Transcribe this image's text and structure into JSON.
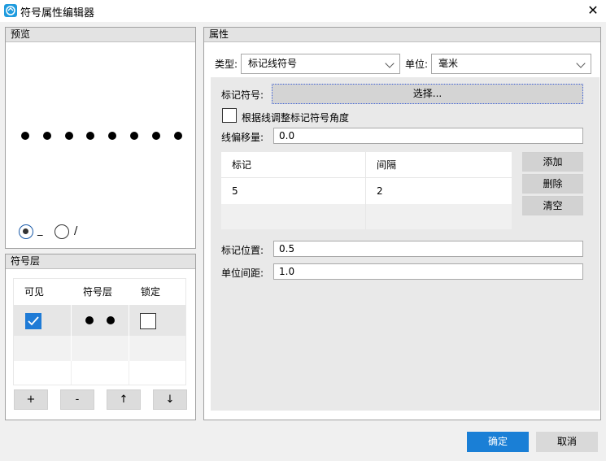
{
  "window": {
    "title": "符号属性编辑器",
    "close_glyph": "✕",
    "app_icon": "app-logo-icon"
  },
  "preview": {
    "header": "预览",
    "dot_count": 8,
    "radio_options": [
      {
        "label": "_",
        "checked": true
      },
      {
        "label": "/",
        "checked": false
      }
    ]
  },
  "layers": {
    "header": "符号层",
    "columns": [
      "可见",
      "符号层",
      "锁定"
    ],
    "rows": [
      {
        "visible": true,
        "locked": false
      }
    ],
    "buttons": {
      "add": "+",
      "remove": "-",
      "up": "↑",
      "down": "↓"
    }
  },
  "properties": {
    "header": "属性",
    "type_label": "类型:",
    "type_value": "标记线符号",
    "unit_label": "单位:",
    "unit_value": "毫米",
    "marker_symbol_label": "标记符号:",
    "select_button": "选择...",
    "adjust_angle_label": "根据线调整标记符号角度",
    "adjust_angle_checked": false,
    "offset_label": "线偏移量:",
    "offset_value": "0.0",
    "marker_table": {
      "columns": [
        "标记",
        "间隔"
      ],
      "rows": [
        {
          "mark": "5",
          "gap": "2"
        }
      ]
    },
    "buttons": {
      "add": "添加",
      "delete": "删除",
      "clear": "清空"
    },
    "marker_position_label": "标记位置:",
    "marker_position_value": "0.5",
    "unit_spacing_label": "单位间距:",
    "unit_spacing_value": "1.0"
  },
  "footer": {
    "ok": "确定",
    "cancel": "取消"
  },
  "colors": {
    "accent": "#1a7fd6",
    "checkbox_checked": "#1f7bd6"
  }
}
